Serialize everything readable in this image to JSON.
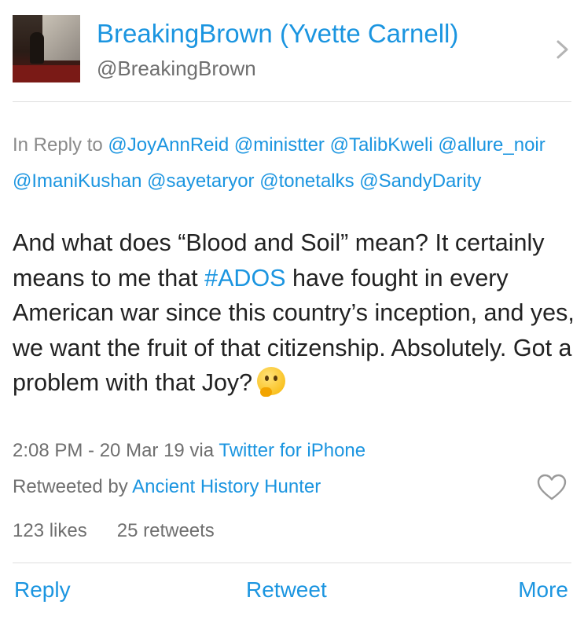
{
  "header": {
    "display_name": "BreakingBrown (Yvette Carnell)",
    "handle": "@BreakingBrown",
    "avatar_icon": "user-avatar",
    "chevron_icon": "chevron-right-icon"
  },
  "reply_to": {
    "prefix": "In Reply to",
    "mentions": [
      "@JoyAnnReid",
      "@ministter",
      "@TalibKweli",
      "@allure_noir",
      "@ImaniKushan",
      "@sayetaryor",
      "@tonetalks",
      "@SandyDarity"
    ]
  },
  "tweet": {
    "text_before_tag": "And what does “Blood and Soil” mean? It certainly means to me that ",
    "hashtag": "#ADOS",
    "text_after_tag": " have fought in every American war since this country’s inception, and yes, we want the fruit of that citizenship. Absolutely. Got a problem with that Joy?",
    "emoji_icon": "thinking-face-emoji"
  },
  "meta": {
    "timestamp": "2:08 PM - 20 Mar 19 via ",
    "source": "Twitter for iPhone"
  },
  "retweeted": {
    "prefix": "Retweeted by ",
    "user": "Ancient History Hunter",
    "like_icon": "heart-icon"
  },
  "stats": {
    "likes": "123 likes",
    "retweets": "25 retweets"
  },
  "actions": {
    "reply": "Reply",
    "retweet": "Retweet",
    "more": "More"
  },
  "colors": {
    "link": "#1b95e0",
    "muted": "#8a8a8a",
    "text": "#222222"
  }
}
